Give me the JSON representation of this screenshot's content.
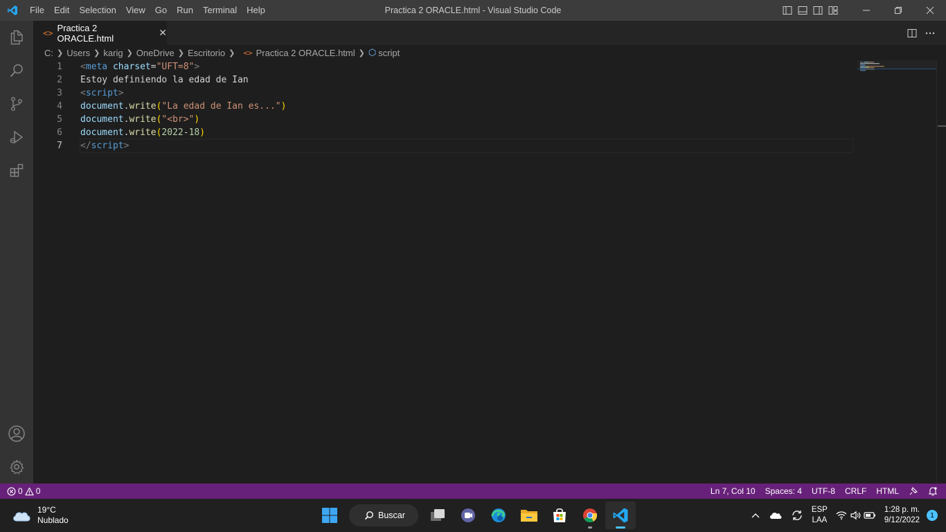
{
  "titlebar": {
    "title": "Practica 2 ORACLE.html - Visual Studio Code",
    "menu": [
      "File",
      "Edit",
      "Selection",
      "View",
      "Go",
      "Run",
      "Terminal",
      "Help"
    ]
  },
  "tab": {
    "icon": "<>",
    "label": "Practica 2 ORACLE.html",
    "close": "✕"
  },
  "breadcrumb": {
    "items": [
      "C:",
      "Users",
      "karig",
      "OneDrive",
      "Escritorio",
      "Practica 2 ORACLE.html",
      "script"
    ]
  },
  "editor": {
    "line_numbers": [
      "1",
      "2",
      "3",
      "4",
      "5",
      "6",
      "7"
    ],
    "active_line": 7,
    "lines": [
      [
        {
          "t": "<",
          "c": "tag"
        },
        {
          "t": "meta",
          "c": "tagname"
        },
        {
          "t": " ",
          "c": "text"
        },
        {
          "t": "charset",
          "c": "attr"
        },
        {
          "t": "=",
          "c": "eq"
        },
        {
          "t": "\"UFT=8\"",
          "c": "str"
        },
        {
          "t": ">",
          "c": "tag"
        }
      ],
      [
        {
          "t": "Estoy definiendo la edad de Ian",
          "c": "text"
        }
      ],
      [
        {
          "t": "<",
          "c": "tag"
        },
        {
          "t": "script",
          "c": "tagname"
        },
        {
          "t": ">",
          "c": "tag"
        }
      ],
      [
        {
          "t": "document",
          "c": "var"
        },
        {
          "t": ".",
          "c": "punc"
        },
        {
          "t": "write",
          "c": "fn"
        },
        {
          "t": "(",
          "c": "paren"
        },
        {
          "t": "\"La edad de Ian es...\"",
          "c": "str"
        },
        {
          "t": ")",
          "c": "paren"
        }
      ],
      [
        {
          "t": "document",
          "c": "var"
        },
        {
          "t": ".",
          "c": "punc"
        },
        {
          "t": "write",
          "c": "fn"
        },
        {
          "t": "(",
          "c": "paren"
        },
        {
          "t": "\"<br>\"",
          "c": "str"
        },
        {
          "t": ")",
          "c": "paren"
        }
      ],
      [
        {
          "t": "document",
          "c": "var"
        },
        {
          "t": ".",
          "c": "punc"
        },
        {
          "t": "write",
          "c": "fn"
        },
        {
          "t": "(",
          "c": "paren"
        },
        {
          "t": "2022",
          "c": "num"
        },
        {
          "t": "-",
          "c": "op"
        },
        {
          "t": "18",
          "c": "num"
        },
        {
          "t": ")",
          "c": "paren"
        }
      ],
      [
        {
          "t": "</",
          "c": "tag"
        },
        {
          "t": "script",
          "c": "tagname"
        },
        {
          "t": ">",
          "c": "tag"
        }
      ]
    ]
  },
  "statusbar": {
    "errors": "0",
    "warnings": "0",
    "position": "Ln 7, Col 10",
    "spaces": "Spaces: 4",
    "encoding": "UTF-8",
    "eol": "CRLF",
    "language": "HTML"
  },
  "taskbar": {
    "temperature": "19°C",
    "condition": "Nublado",
    "search_label": "Buscar",
    "lang_top": "ESP",
    "lang_bottom": "LAA",
    "time": "1:28 p. m.",
    "date": "9/12/2022",
    "notifications": "1"
  },
  "colors": {
    "statusbar": "#68217a",
    "titlebar": "#3c3c3c",
    "activitybar": "#333333",
    "editor": "#1e1e1e",
    "accent": "#007acc"
  }
}
